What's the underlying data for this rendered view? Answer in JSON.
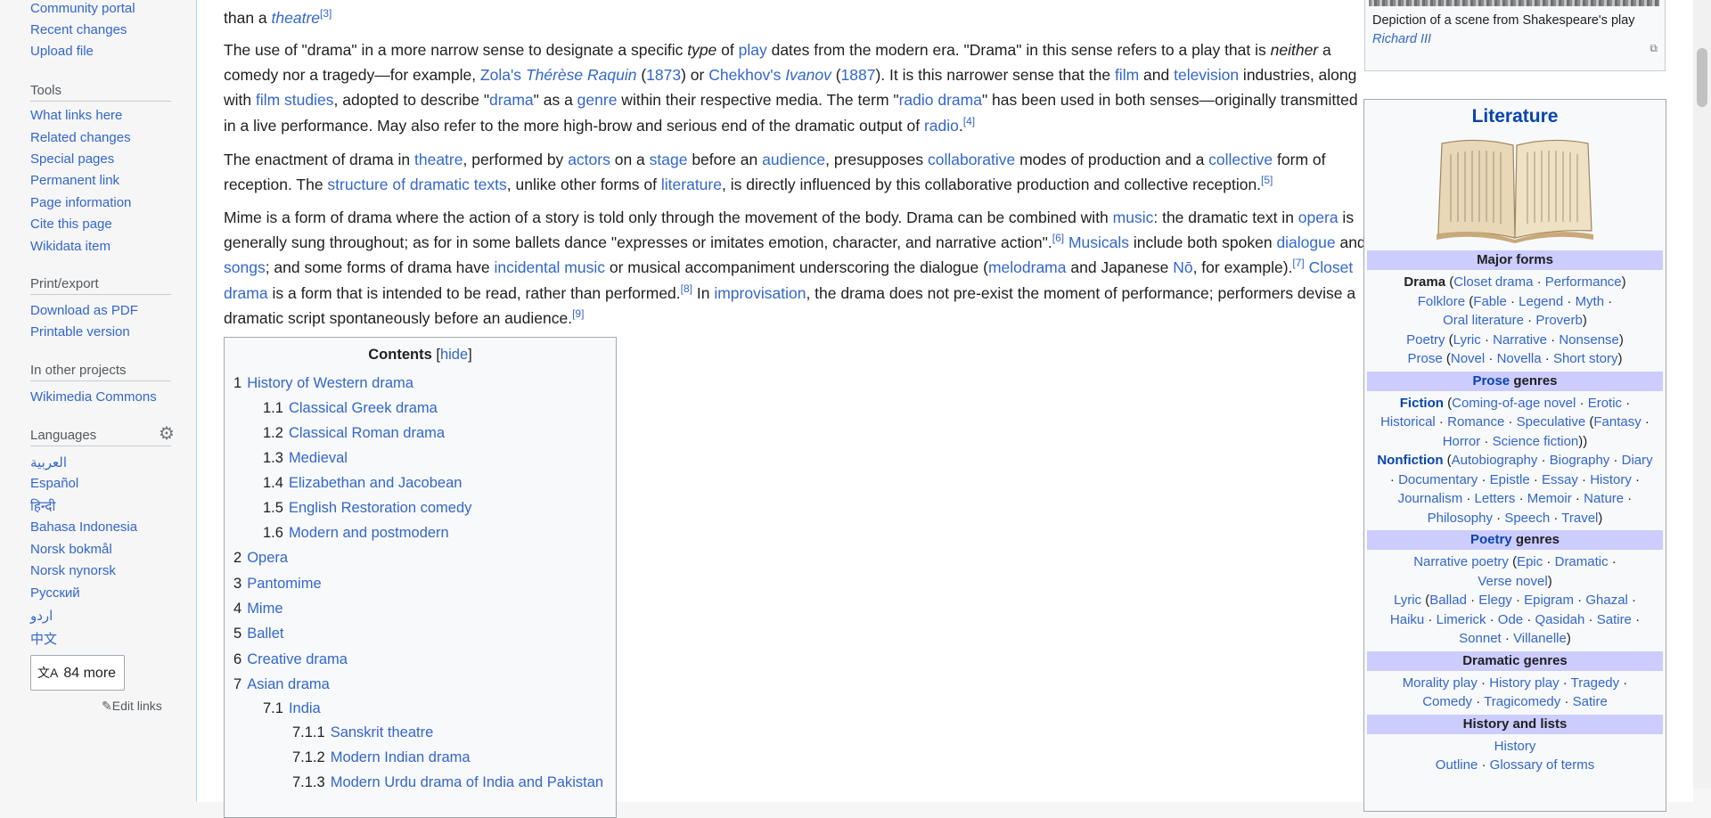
{
  "sidebar": {
    "top_links": [
      "Community portal",
      "Recent changes",
      "Upload file"
    ],
    "tools_heading": "Tools",
    "tools": [
      "What links here",
      "Related changes",
      "Special pages",
      "Permanent link",
      "Page information",
      "Cite this page",
      "Wikidata item"
    ],
    "print_heading": "Print/export",
    "print": [
      "Download as PDF",
      "Printable version"
    ],
    "projects_heading": "In other projects",
    "projects": [
      "Wikimedia Commons"
    ],
    "languages_heading": "Languages",
    "languages": [
      "العربية",
      "Español",
      "हिन्दी",
      "Bahasa Indonesia",
      "Norsk bokmål",
      "Norsk nynorsk",
      "Русский",
      "اردو",
      "中文"
    ],
    "more_label": "84 more",
    "edit_links": "Edit links"
  },
  "article": {
    "p0": {
      "pre": "than a ",
      "link": "theatre",
      "ref": "[3]"
    },
    "p1": {
      "t1": "The use of \"drama\" in a more narrow sense to designate a specific ",
      "i1": "type",
      "t2": " of ",
      "l1": "play",
      "t3": " dates from the modern era. \"Drama\" in this sense refers to a play that is ",
      "i2": "neither",
      "t4": " a comedy nor a tragedy—for example, ",
      "l2": "Zola's",
      "t5": " ",
      "l3": "Thérèse Raquin",
      "t6": " (",
      "l4": "1873",
      "t7": ") or ",
      "l5": "Chekhov's",
      "t8": " ",
      "l6": "Ivanov",
      "t9": " (",
      "l7": "1887",
      "t10": "). It is this narrower sense that the ",
      "l8": "film",
      "t11": " and ",
      "l9": "television",
      "t12": " industries, along with ",
      "l10": "film studies",
      "t13": ", adopted to describe \"",
      "l11": "drama",
      "t14": "\" as a ",
      "l12": "genre",
      "t15": " within their respective media. The term \"",
      "l13": "radio drama",
      "t16": "\" has been used in both senses—originally transmitted in a live performance. May also refer to the more high-brow and serious end of the dramatic output of ",
      "l14": "radio",
      "t17": ".",
      "ref": "[4]"
    },
    "p2": {
      "t1": "The enactment of drama in ",
      "l1": "theatre",
      "t2": ", performed by ",
      "l2": "actors",
      "t3": " on a ",
      "l3": "stage",
      "t4": " before an ",
      "l4": "audience",
      "t5": ", presupposes ",
      "l5": "collaborative",
      "t6": " modes of production and a ",
      "l6": "collective",
      "t7": " form of reception. The ",
      "l7": "structure of dramatic texts",
      "t8": ", unlike other forms of ",
      "l8": "literature",
      "t9": ", is directly influenced by this collaborative production and collective reception.",
      "ref": "[5]"
    },
    "p3": {
      "t1": "Mime is a form of drama where the action of a story is told only through the movement of the body. Drama can be combined with ",
      "l1": "music",
      "t2": ": the dramatic text in ",
      "l2": "opera",
      "t3": " is generally sung throughout; as for in some ballets dance \"expresses or imitates emotion, character, and narrative action\".",
      "ref1": "[6]",
      "t4": " ",
      "l3": "Musicals",
      "t5": " include both spoken ",
      "l4": "dialogue",
      "t6": " and ",
      "l5": "songs",
      "t7": "; and some forms of drama have ",
      "l6": "incidental music",
      "t8": " or musical accompaniment underscoring the dialogue (",
      "l7": "melodrama",
      "t9": " and Japanese ",
      "l8": "Nō",
      "t10": ", for example).",
      "ref2": "[7]",
      "t11": " ",
      "l9": "Closet drama",
      "t12": " is a form that is intended to be read, rather than performed.",
      "ref3": "[8]",
      "t13": " In ",
      "l10": "improvisation",
      "t14": ", the drama does not pre-exist the moment of performance; performers devise a dramatic script spontaneously before an audience.",
      "ref4": "[9]"
    }
  },
  "toc": {
    "title": "Contents",
    "hide": "hide",
    "items": [
      {
        "num": "1",
        "label": "History of Western drama"
      },
      {
        "num": "1.1",
        "label": "Classical Greek drama"
      },
      {
        "num": "1.2",
        "label": "Classical Roman drama"
      },
      {
        "num": "1.3",
        "label": "Medieval"
      },
      {
        "num": "1.4",
        "label": "Elizabethan and Jacobean"
      },
      {
        "num": "1.5",
        "label": "English Restoration comedy"
      },
      {
        "num": "1.6",
        "label": "Modern and postmodern"
      },
      {
        "num": "2",
        "label": "Opera"
      },
      {
        "num": "3",
        "label": "Pantomime"
      },
      {
        "num": "4",
        "label": "Mime"
      },
      {
        "num": "5",
        "label": "Ballet"
      },
      {
        "num": "6",
        "label": "Creative drama"
      },
      {
        "num": "7",
        "label": "Asian drama"
      },
      {
        "num": "7.1",
        "label": "India"
      },
      {
        "num": "7.1.1",
        "label": "Sanskrit theatre"
      },
      {
        "num": "7.1.2",
        "label": "Modern Indian drama"
      },
      {
        "num": "7.1.3",
        "label": "Modern Urdu drama of India and Pakistan"
      }
    ]
  },
  "caption": {
    "text": "Depiction of a scene from Shakespeare's play ",
    "link": "Richard III"
  },
  "navbox": {
    "title": "Literature",
    "major_forms_head": "Major forms",
    "drama_label": "Drama",
    "drama_items": [
      "Closet drama",
      "Performance"
    ],
    "folklore_label": "Folklore",
    "folklore_items": [
      "Fable",
      "Legend",
      "Myth",
      "Oral literature",
      "Proverb"
    ],
    "poetry_label": "Poetry",
    "poetry_items": [
      "Lyric",
      "Narrative",
      "Nonsense"
    ],
    "prose_label": "Prose",
    "prose_items": [
      "Novel",
      "Novella",
      "Short story"
    ],
    "prose_genres_head_link": "Prose",
    "genres_word": "genres",
    "fiction_label": "Fiction",
    "fiction_items_a": [
      "Coming-of-age novel",
      "Erotic",
      "Historical",
      "Romance",
      "Speculative"
    ],
    "speculative_items": [
      "Fantasy",
      "Horror",
      "Science fiction"
    ],
    "nonfiction_label": "Nonfiction",
    "nonfiction_items": [
      "Autobiography",
      "Biography",
      "Diary",
      "Documentary",
      "Epistle",
      "Essay",
      "History",
      "Journalism",
      "Letters",
      "Memoir",
      "Nature",
      "Philosophy",
      "Speech",
      "Travel"
    ],
    "poetry_genres_head_link": "Poetry",
    "narrative_poetry_label": "Narrative poetry",
    "narrative_poetry_items": [
      "Epic",
      "Dramatic",
      "Verse novel"
    ],
    "lyric_label": "Lyric",
    "lyric_items": [
      "Ballad",
      "Elegy",
      "Epigram",
      "Ghazal",
      "Haiku",
      "Limerick",
      "Ode",
      "Qasidah",
      "Satire",
      "Sonnet",
      "Villanelle"
    ],
    "dramatic_genres_head": "Dramatic genres",
    "dramatic_items": [
      "Morality play",
      "History play",
      "Tragedy",
      "Comedy",
      "Tragicomedy",
      "Satire"
    ],
    "history_head": "History and lists",
    "history_items": [
      "History",
      "Outline",
      "Glossary of terms"
    ]
  },
  "colors": {
    "link": "#3366cc",
    "navbox_head": "#ccccff",
    "sidebar_bg": "#f6f6f6"
  }
}
